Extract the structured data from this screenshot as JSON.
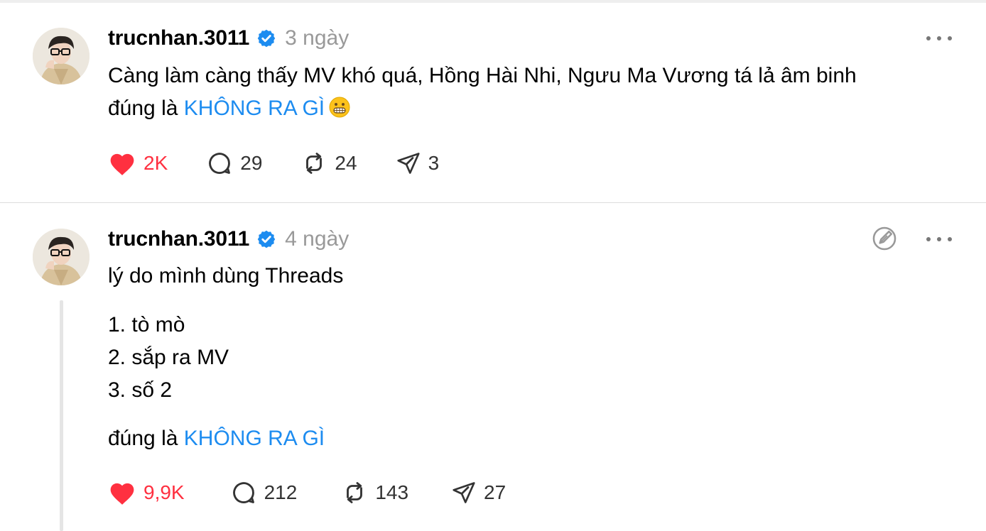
{
  "posts": [
    {
      "username": "trucnhan.3011",
      "time": "3 ngày",
      "line1": "Càng làm càng thấy MV khó quá, Hồng Hài Nhi, Ngưu Ma Vương tá lả âm binh",
      "line2_prefix": "đúng là ",
      "link": "KHÔNG RA GÌ",
      "emoji": "grimacing-face",
      "likes": "2K",
      "replies": "29",
      "reposts": "24",
      "shares": "3"
    },
    {
      "username": "trucnhan.3011",
      "time": "4 ngày",
      "line1": "lý do mình dùng Threads",
      "list": [
        "1. tò mò",
        "2. sắp ra MV",
        "3. số 2"
      ],
      "last_prefix": "đúng là ",
      "link": "KHÔNG RA GÌ",
      "likes": "9,9K",
      "replies": "212",
      "reposts": "143",
      "shares": "27"
    }
  ],
  "colors": {
    "link": "#1d8cf0",
    "like": "#ff3040",
    "verified": "#1d8cf0",
    "muted": "#999999"
  },
  "icons": [
    "verified-badge-icon",
    "more-icon",
    "heart-icon",
    "comment-icon",
    "repost-icon",
    "share-icon",
    "edit-icon",
    "grimacing-emoji"
  ]
}
